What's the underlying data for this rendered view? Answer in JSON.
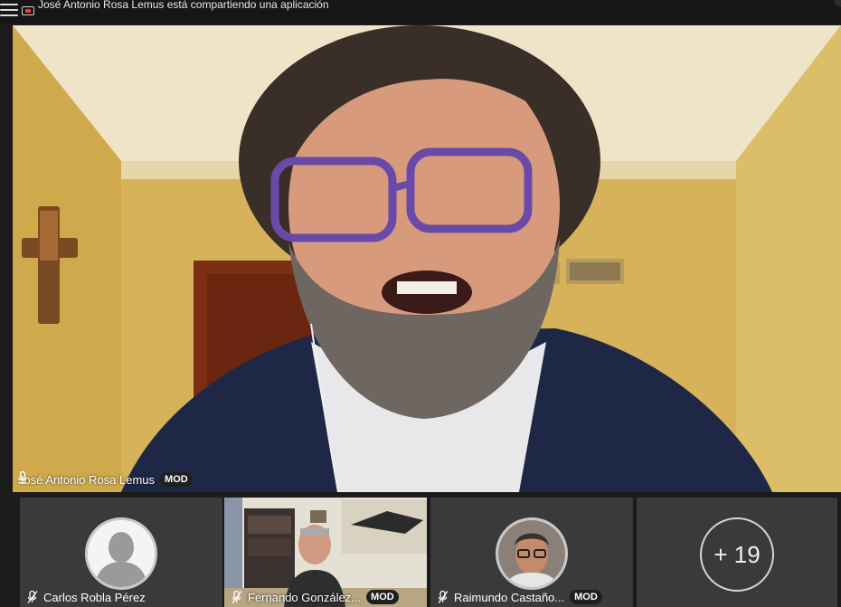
{
  "banner": {
    "message": "José Antonio Rosa Lemus está compartiendo una aplicación"
  },
  "main": {
    "name": "José Antonio Rosa Lemus",
    "badge": "MOD"
  },
  "participants": [
    {
      "name": "Carlos Robla Pérez",
      "badge": ""
    },
    {
      "name": "Fernando González...",
      "badge": "MOD"
    },
    {
      "name": "Raimundo Castaño...",
      "badge": "MOD"
    }
  ],
  "more": {
    "label": "+ 19"
  },
  "colors": {
    "background": "#1b1b1b",
    "tile": "#3a3a3a",
    "badge_bg": "#1f1f1f",
    "wall": "#d8b45c",
    "sweater": "#1f2a4a"
  }
}
